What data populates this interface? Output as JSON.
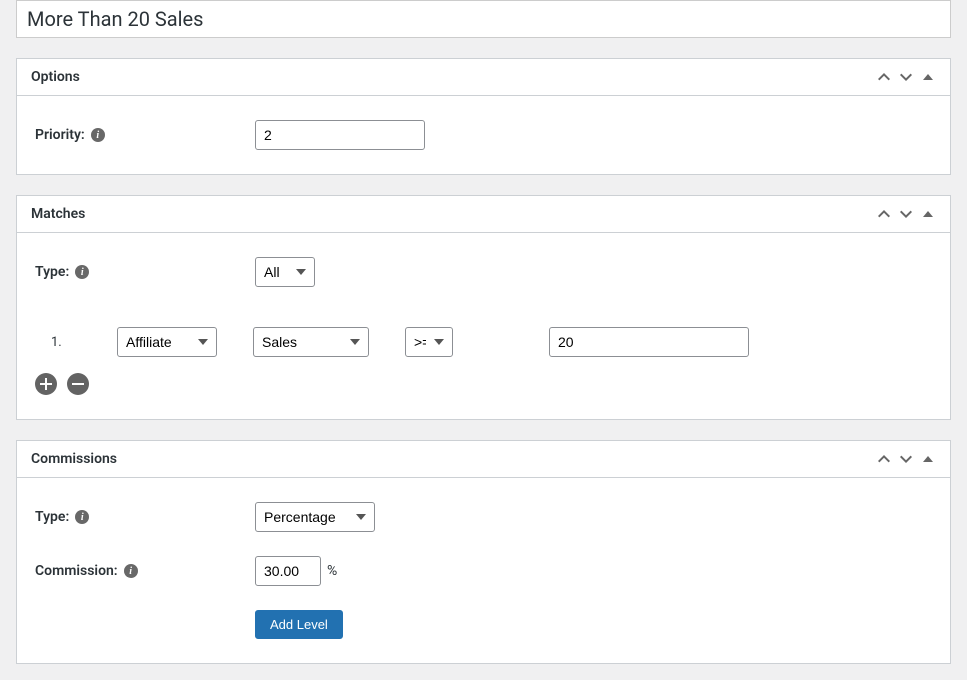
{
  "title": "More Than 20 Sales",
  "optionsPanel": {
    "title": "Options",
    "priorityLabel": "Priority:",
    "priorityValue": "2"
  },
  "matchesPanel": {
    "title": "Matches",
    "typeLabel": "Type:",
    "typeValue": "All",
    "condition": {
      "index": "1.",
      "entity": "Affiliate",
      "metric": "Sales",
      "operator": ">=",
      "value": "20"
    }
  },
  "commissionsPanel": {
    "title": "Commissions",
    "typeLabel": "Type:",
    "typeValue": "Percentage",
    "commissionLabel": "Commission:",
    "commissionValue": "30.00",
    "commissionSuffix": "%",
    "addLevelLabel": "Add Level"
  }
}
